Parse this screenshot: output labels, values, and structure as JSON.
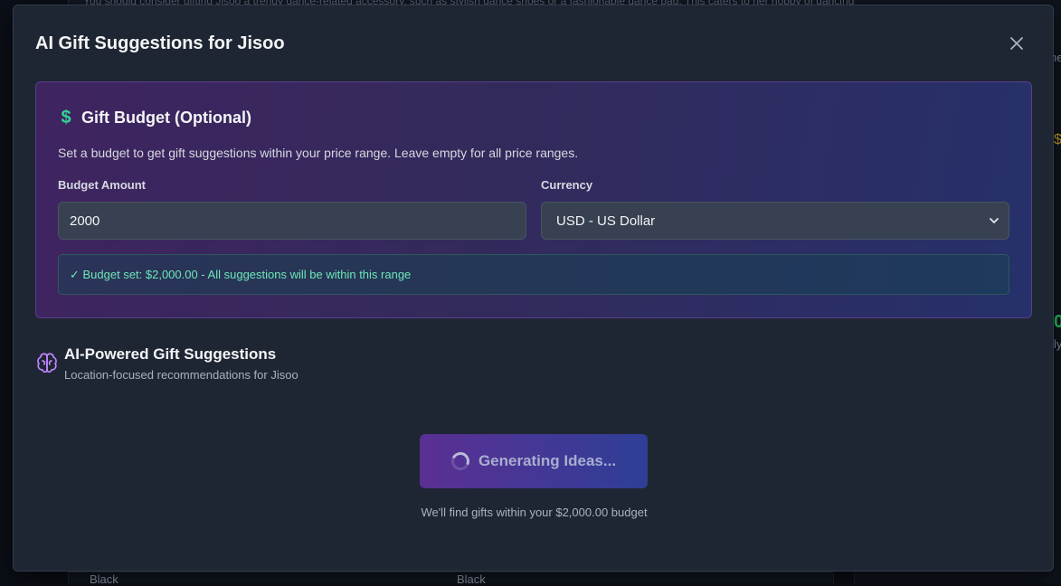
{
  "background": {
    "top_text": "You should consider gifting Jisoo a trendy dance-related accessory, such as stylish dance shoes or a fashionable dance bag. This caters to her hobby of dancing and aligns with her 'Casual, Trendy' style. As",
    "bottom_left": "Black",
    "bottom_mid": "Black",
    "right_marks": [
      "ne",
      "$",
      "0",
      "ly"
    ]
  },
  "modal": {
    "title": "AI Gift Suggestions for Jisoo",
    "close_icon": "close-icon"
  },
  "budget": {
    "title": "Gift Budget (Optional)",
    "icon": "dollar-icon",
    "description": "Set a budget to get gift suggestions within your price range. Leave empty for all price ranges.",
    "amount_label": "Budget Amount",
    "amount_value": "2000",
    "currency_label": "Currency",
    "currency_value": "USD - US Dollar",
    "status": "✓ Budget set: $2,000.00 - All suggestions will be within this range",
    "accent_color": "#34d399"
  },
  "ai": {
    "title": "AI-Powered Gift Suggestions",
    "subtitle": "Location-focused recommendations for Jisoo",
    "icon": "brain-icon",
    "button_label": "Generating Ideas...",
    "note": "We'll find gifts within your $2,000.00 budget"
  }
}
